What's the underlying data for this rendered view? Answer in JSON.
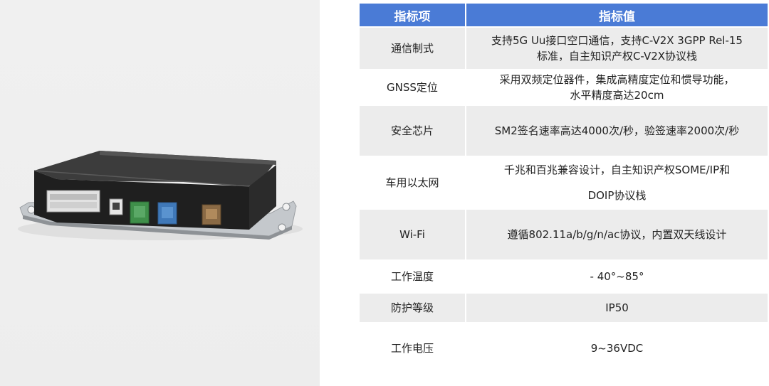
{
  "table": {
    "headers": {
      "item": "指标项",
      "value": "指标值"
    },
    "rows": [
      {
        "name": "通信制式",
        "value_line1": "支持5G Uu接口空口通信，支持C-V2X 3GPP Rel-15",
        "value_line2": "标准，自主知识产权C-V2X协议栈"
      },
      {
        "name": "GNSS定位",
        "value_line1": "采用双频定位器件，集成高精度定位和惯导功能，",
        "value_line2": "水平精度高达20cm"
      },
      {
        "name": "安全芯片",
        "value": "SM2签名速率高达4000次/秒，验签速率2000次/秒"
      },
      {
        "name": "车用以太网",
        "value_line1": "千兆和百兆兼容设计，自主知识产权SOME/IP和",
        "value_line2": "DOIP协议栈"
      },
      {
        "name": "Wi-Fi",
        "value": "遵循802.11a/b/g/n/ac协议，内置双天线设计"
      },
      {
        "name": "工作温度",
        "value": "- 40°~85°"
      },
      {
        "name": "防护等级",
        "value": "IP50"
      },
      {
        "name": "工作电压",
        "value": "9~36VDC"
      }
    ]
  },
  "colors": {
    "header_bg": "#4a7bd6",
    "row_bg": "#ececec",
    "photo_bg": "#efefef"
  }
}
